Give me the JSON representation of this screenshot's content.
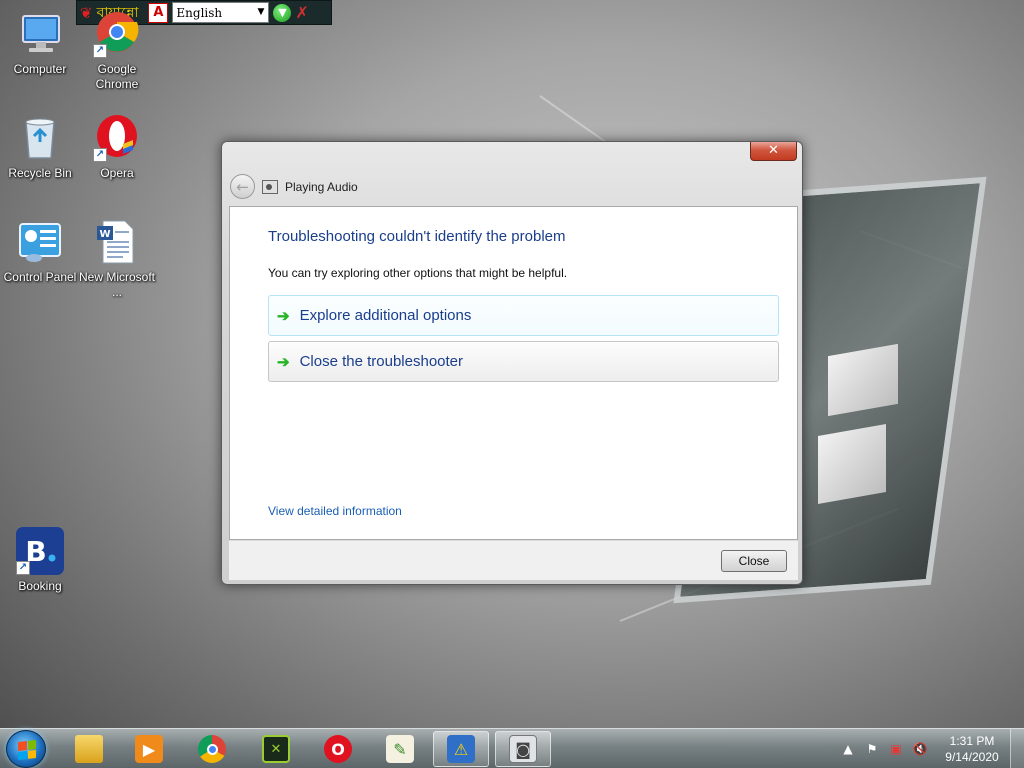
{
  "language_bar": {
    "app_name": "বায়ান্নো",
    "selected_language": "English",
    "icons": [
      "bijoy-logo-icon",
      "pdf-icon",
      "download-icon",
      "close-icon"
    ]
  },
  "desktop_icons": [
    {
      "label": "Computer",
      "icon": "computer-icon"
    },
    {
      "label": "Google Chrome",
      "icon": "chrome-icon"
    },
    {
      "label": "Recycle Bin",
      "icon": "recycle-bin-icon"
    },
    {
      "label": "Opera",
      "icon": "opera-icon"
    },
    {
      "label": "Control Panel",
      "icon": "control-panel-icon"
    },
    {
      "label": "New Microsoft ...",
      "icon": "word-document-icon"
    },
    {
      "label": "Booking",
      "icon": "booking-icon"
    }
  ],
  "dialog": {
    "title": "Playing Audio",
    "close_glyph": "✕",
    "heading": "Troubleshooting couldn't identify the problem",
    "subtext": "You can try exploring other options that might be helpful.",
    "options": [
      {
        "label": "Explore additional options"
      },
      {
        "label": "Close the troubleshooter"
      }
    ],
    "detail_link": "View detailed information",
    "close_button": "Close"
  },
  "taskbar": {
    "pinned": [
      "windows-explorer-icon",
      "media-player-icon",
      "chrome-icon",
      "terminal-app-icon",
      "opera-icon",
      "notepad-pen-icon",
      "action-center-troubleshooter-icon",
      "audio-troubleshooter-icon"
    ],
    "active_items": [
      "action-center-troubleshooter-icon",
      "audio-troubleshooter-icon"
    ],
    "tray_icons": [
      "show-hidden-icons-arrow",
      "action-center-flag-icon",
      "network-icon",
      "volume-muted-icon"
    ],
    "time": "1:31 PM",
    "date": "9/14/2020"
  },
  "colors": {
    "heading_blue": "#1a3e8c",
    "link_blue": "#1a5fb4",
    "arrow_green": "#27b527",
    "close_red": "#c23b21"
  }
}
